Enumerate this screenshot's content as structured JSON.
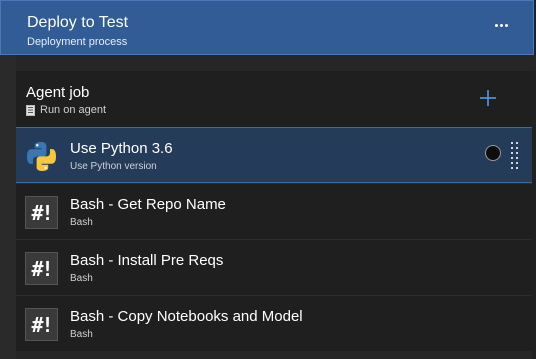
{
  "stage": {
    "title": "Deploy to Test",
    "subtitle": "Deployment process",
    "more_icon": "ellipsis-icon"
  },
  "job": {
    "title": "Agent job",
    "subtitle": "Run on agent",
    "server_icon": "server-icon",
    "add_icon": "plus-icon"
  },
  "tasks": [
    {
      "title": "Use Python 3.6",
      "subtitle": "Use Python version",
      "icon": "python-icon",
      "selected": true
    },
    {
      "title": "Bash - Get Repo Name",
      "subtitle": "Bash",
      "icon": "bash-icon",
      "icon_text": "#!",
      "selected": false
    },
    {
      "title": "Bash - Install Pre Reqs",
      "subtitle": "Bash",
      "icon": "bash-icon",
      "icon_text": "#!",
      "selected": false
    },
    {
      "title": "Bash - Copy Notebooks and Model",
      "subtitle": "Bash",
      "icon": "bash-icon",
      "icon_text": "#!",
      "selected": false
    }
  ],
  "colors": {
    "stage_bg": "#315c95",
    "selected_bg": "#253b5a",
    "accent": "#4a9be8",
    "panel_bg": "#1f1f1f"
  }
}
